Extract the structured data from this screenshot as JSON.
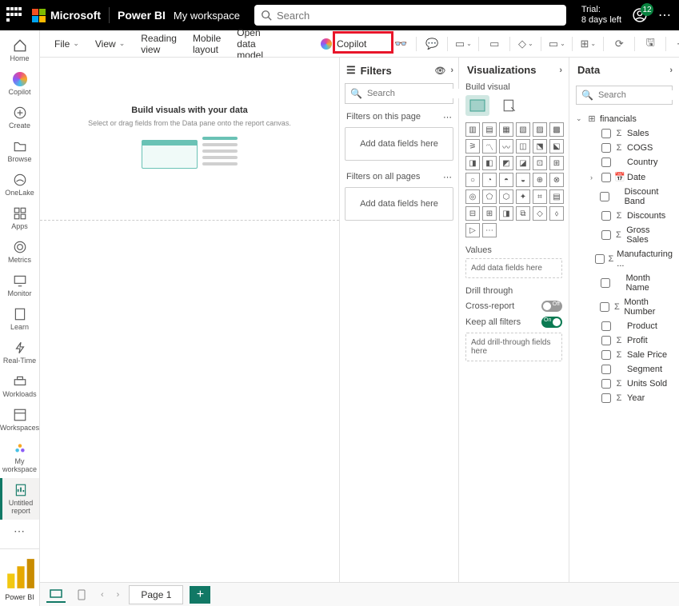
{
  "header": {
    "company": "Microsoft",
    "product": "Power BI",
    "workspace": "My workspace",
    "search_placeholder": "Search",
    "trial_line1": "Trial:",
    "trial_line2": "8 days left",
    "notification_count": "12"
  },
  "leftrail": {
    "items": [
      "Home",
      "Copilot",
      "Create",
      "Browse",
      "OneLake",
      "Apps",
      "Metrics",
      "Monitor",
      "Learn",
      "Real-Time",
      "Workloads",
      "Workspaces",
      "My workspace",
      "Untitled report"
    ],
    "bottom": "Power BI"
  },
  "toolbar": {
    "file": "File",
    "view": "View",
    "reading_view": "Reading view",
    "mobile_layout": "Mobile layout",
    "open_data_model": "Open data model",
    "copilot": "Copilot"
  },
  "filters": {
    "title": "Filters",
    "search_placeholder": "Search",
    "on_this_page": "Filters on this page",
    "on_all_pages": "Filters on all pages",
    "add_fields": "Add data fields here"
  },
  "viz": {
    "title": "Visualizations",
    "build": "Build visual",
    "values": "Values",
    "add_fields": "Add data fields here",
    "drill_through": "Drill through",
    "cross_report": "Cross-report",
    "keep_filters": "Keep all filters",
    "add_drill": "Add drill-through fields here",
    "off": "Off",
    "on": "On"
  },
  "data": {
    "title": "Data",
    "search_placeholder": "Search",
    "table": "financials",
    "fields": [
      {
        "name": "Sales",
        "type": "sum"
      },
      {
        "name": "COGS",
        "type": "sum"
      },
      {
        "name": "Country",
        "type": "text"
      },
      {
        "name": "Date",
        "type": "date",
        "expandable": true
      },
      {
        "name": "Discount Band",
        "type": "text"
      },
      {
        "name": "Discounts",
        "type": "sum"
      },
      {
        "name": "Gross Sales",
        "type": "sum"
      },
      {
        "name": "Manufacturing ...",
        "type": "sum"
      },
      {
        "name": "Month Name",
        "type": "text"
      },
      {
        "name": "Month Number",
        "type": "sum"
      },
      {
        "name": "Product",
        "type": "text"
      },
      {
        "name": "Profit",
        "type": "sum"
      },
      {
        "name": "Sale Price",
        "type": "sum"
      },
      {
        "name": "Segment",
        "type": "text"
      },
      {
        "name": "Units Sold",
        "type": "sum"
      },
      {
        "name": "Year",
        "type": "sum"
      }
    ]
  },
  "canvas": {
    "title": "Build visuals with your data",
    "sub": "Select or drag fields from the Data pane onto the report canvas."
  },
  "bottom": {
    "page": "Page 1"
  }
}
